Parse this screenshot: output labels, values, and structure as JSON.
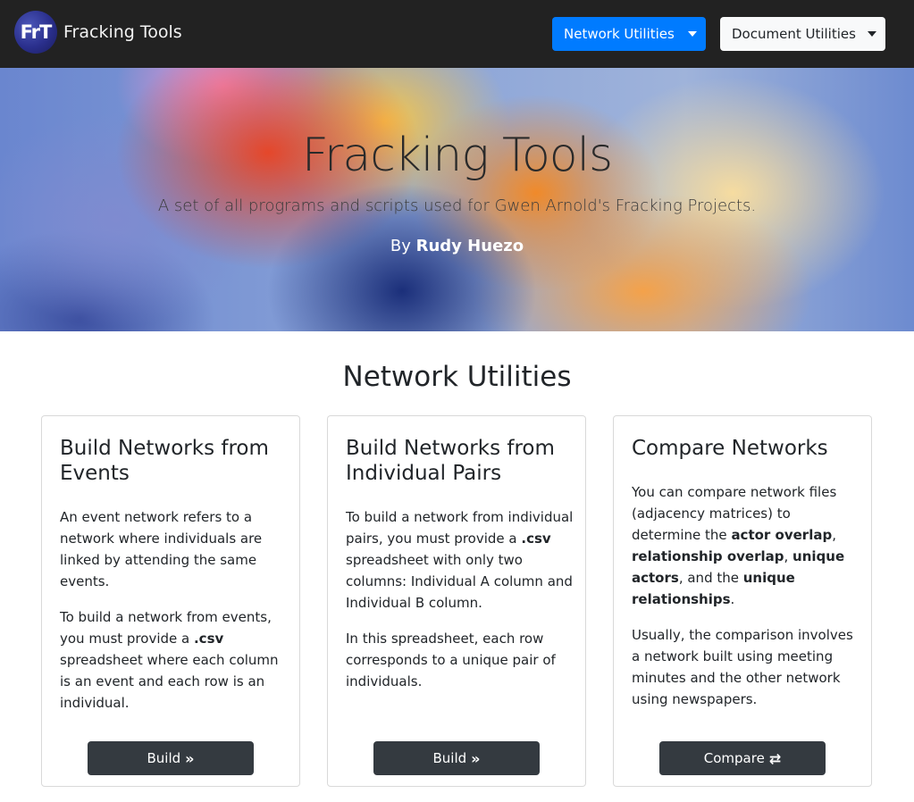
{
  "navbar": {
    "logo_text": "FrT",
    "brand": "Fracking Tools",
    "network_dropdown": "Network Utilities",
    "document_dropdown": "Document Utilities"
  },
  "hero": {
    "title": "Fracking Tools",
    "subtitle": "A set of all programs and scripts used for Gwen Arnold's Fracking Projects.",
    "by_prefix": "By",
    "author": "Rudy Huezo"
  },
  "section": {
    "title": "Network Utilities"
  },
  "cards": [
    {
      "title": "Build Networks from Events",
      "p1": "An event network refers to a network where individuals are linked by attending the same events.",
      "p2_pre": "To build a network from events, you must provide a ",
      "p2_bold": ".csv",
      "p2_post": " spreadsheet where each column is an event and each row is an individual.",
      "button": "Build",
      "button_icon": "double-chevron-right-icon"
    },
    {
      "title": "Build Networks from Individual Pairs",
      "p1_pre": "To build a network from individual pairs, you must provide a ",
      "p1_bold": ".csv",
      "p1_post": " spreadsheet with only two columns: Individual A column and Individual B column.",
      "p2": "In this spreadsheet, each row corresponds to a unique pair of individuals.",
      "button": "Build",
      "button_icon": "double-chevron-right-icon"
    },
    {
      "title": "Compare Networks",
      "p1_a": "You can compare network files (adjacency matrices) to determine the ",
      "p1_b1": "actor overlap",
      "p1_c": ", ",
      "p1_b2": "relationship overlap",
      "p1_d": ", ",
      "p1_b3": "unique actors",
      "p1_e": ", and the ",
      "p1_b4": "unique relationships",
      "p1_f": ".",
      "p2": "Usually, the comparison involves a network built using meeting minutes and the other network using newspapers.",
      "button": "Compare",
      "button_icon": "exchange-arrows-icon"
    }
  ],
  "colors": {
    "navbar_bg": "#222222",
    "primary": "#007bff",
    "light": "#f8f9fa",
    "dark_button": "#343a40"
  }
}
